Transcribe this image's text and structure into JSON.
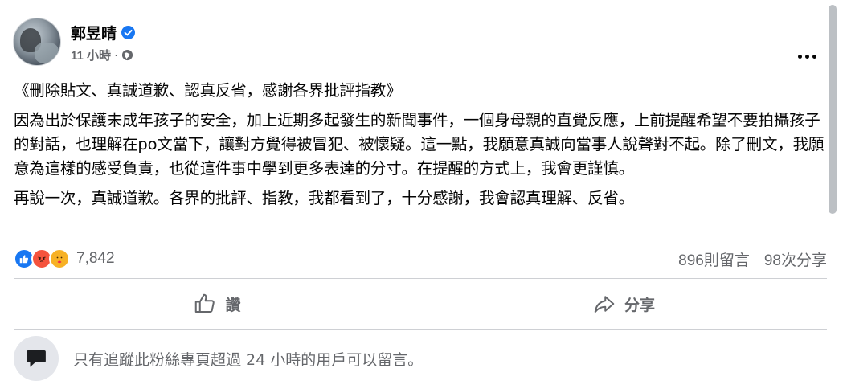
{
  "author": {
    "name": "郭昱晴",
    "time": "11 小時",
    "separator": "·"
  },
  "post": {
    "paragraphs": [
      "《刪除貼文、真誠道歉、認真反省，感謝各界批評指教》",
      "因為出於保護未成年孩子的安全，加上近期多起發生的新聞事件，一個身母親的直覺反應，上前提醒希望不要拍攝孩子的對話，也理解在po文當下，讓對方覺得被冒犯、被懷疑。這一點，我願意真誠向當事人說聲對不起。除了刪文，我願意為這樣的感受負責，也從這件事中學到更多表達的分寸。在提醒的方式上，我會更謹慎。",
      "再說一次，真誠道歉。各界的批評、指教，我都看到了，十分感謝，我會認真理解、反省。"
    ]
  },
  "reactions": {
    "count": "7,842",
    "types": [
      "like-icon",
      "angry-icon",
      "care-icon"
    ],
    "comments": "896則留言",
    "shares": "98次分享"
  },
  "actions": {
    "like_label": "讚",
    "share_label": "分享"
  },
  "comment_box": {
    "note": "只有追蹤此粉絲專頁超過 24 小時的用戶可以留言。"
  },
  "colors": {
    "primary_text": "#050505",
    "secondary_text": "#65676b",
    "verified": "#1877f2",
    "divider": "#ced0d4"
  }
}
